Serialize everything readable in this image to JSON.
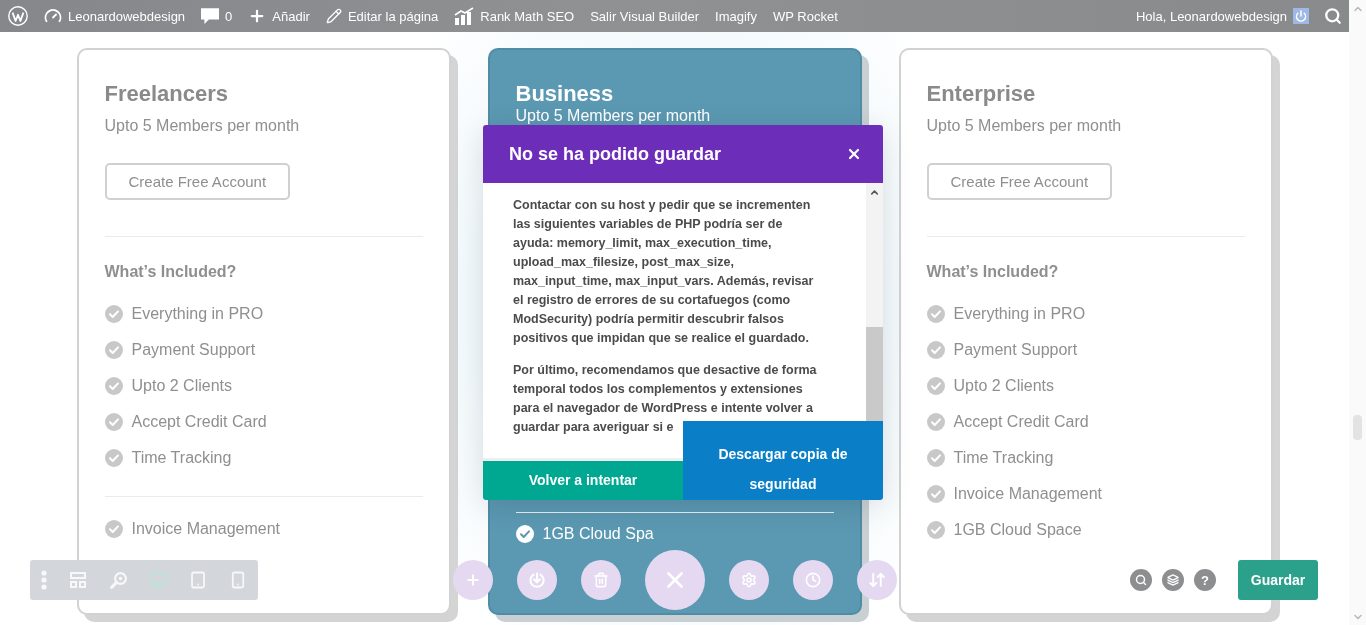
{
  "admin_bar": {
    "items": [
      {
        "kind": "logo"
      },
      {
        "kind": "site",
        "label": "Leonardowebdesign"
      },
      {
        "kind": "comments",
        "label": "0"
      },
      {
        "kind": "new",
        "label": "Añadir"
      },
      {
        "kind": "edit",
        "label": "Editar la página"
      },
      {
        "kind": "seo",
        "label": "Rank Math SEO"
      },
      {
        "kind": "link",
        "label": "Salir Visual Builder"
      },
      {
        "kind": "link",
        "label": "Imagify"
      },
      {
        "kind": "link",
        "label": "WP Rocket"
      }
    ],
    "account": "Hola, Leonardowebdesign"
  },
  "pricing_cards": [
    {
      "title": "Freelancers",
      "subtitle": "Upto 5 Members per month",
      "highlighted": false,
      "button": "Create Free Account",
      "included_heading": "What’s Included?",
      "features": [
        "Everything in PRO",
        "Payment Support",
        "Upto 2 Clients",
        "Accept Credit Card",
        "Time Tracking"
      ],
      "extra_features": [
        "Invoice Management"
      ]
    },
    {
      "title": "Business",
      "subtitle": "Upto 5 Members per month",
      "highlighted": true,
      "extra_features": [
        "1GB Cloud Spa"
      ]
    },
    {
      "title": "Enterprise",
      "subtitle": "Upto 5 Members per month",
      "highlighted": false,
      "button": "Create Free Account",
      "included_heading": "What’s Included?",
      "features": [
        "Everything in PRO",
        "Payment Support",
        "Upto 2 Clients",
        "Accept Credit Card",
        "Time Tracking",
        "Invoice Management",
        "1GB Cloud Space"
      ]
    }
  ],
  "view_toolbar": {
    "tools": [
      {
        "kind": "menu",
        "selected": false
      },
      {
        "kind": "wireframe",
        "selected": false
      },
      {
        "kind": "zoom",
        "selected": false
      },
      {
        "kind": "desktop",
        "selected": true
      },
      {
        "kind": "tablet",
        "selected": false
      },
      {
        "kind": "phone",
        "selected": false
      }
    ]
  },
  "page_actions": [
    {
      "kind": "add"
    },
    {
      "kind": "portability"
    },
    {
      "kind": "clear"
    },
    {
      "kind": "exit"
    },
    {
      "kind": "settings"
    },
    {
      "kind": "history"
    },
    {
      "kind": "sort"
    }
  ],
  "help_actions": [
    {
      "kind": "find"
    },
    {
      "kind": "layers"
    },
    {
      "kind": "help",
      "label": "?"
    }
  ],
  "save_button": "Guardar",
  "error_dialog": {
    "title": "No se ha podido guardar",
    "paragraphs": [
      "Contactar con su host y pedir que se incrementen las siguientes variables de PHP podría ser de ayuda: memory_limit, max_execution_time, upload_max_filesize, post_max_size, max_input_time, max_input_vars. Además, revisar el registro de errores de su cortafuegos (como ModSecurity) podría permitir descubrir falsos positivos que impidan que se realice el guardado.",
      "Por último, recomendamos que desactive de forma temporal todos los complementos y extensiones para el navegador de WordPress e intente volver a guardar para averiguar si e"
    ],
    "buttons": [
      {
        "kind": "retry",
        "label": "Volver a intentar"
      },
      {
        "kind": "backup",
        "label": "Descargar copia de seguridad"
      }
    ]
  }
}
